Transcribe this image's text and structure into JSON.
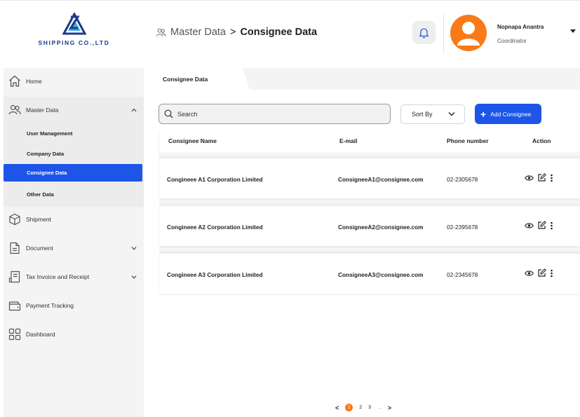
{
  "brand": {
    "name": "SHIPPING CO.,LTD"
  },
  "breadcrumb": {
    "parent": "Master Data",
    "separator": ">",
    "current": "Consignee Data"
  },
  "user": {
    "name": "Nopnapa Anantra",
    "role": "Coordinator"
  },
  "sidebar": {
    "items": [
      {
        "label": "Home"
      },
      {
        "label": "Master Data"
      },
      {
        "label": "Shipment"
      },
      {
        "label": "Document"
      },
      {
        "label": "Tax Invoice and Receipt"
      },
      {
        "label": "Payment Tracking"
      },
      {
        "label": "Dashboard"
      }
    ],
    "sub_items": [
      {
        "label": "User Management"
      },
      {
        "label": "Company Data"
      },
      {
        "label": "Consignee Data"
      },
      {
        "label": "Other Data"
      }
    ],
    "active_sub": "Consignee Data"
  },
  "tab": {
    "label": "Consignee Data"
  },
  "toolbar": {
    "search_placeholder": "Search",
    "sort_label": "Sort By",
    "add_label": "Add Consignee"
  },
  "table": {
    "headers": [
      "Consignee Name",
      "E-mail",
      "Phone number",
      "Action"
    ],
    "rows": [
      {
        "name": "Congineee A1 Corporation Limited",
        "email": "ConsigneeA1@consignee.com",
        "phone": "02-2305678"
      },
      {
        "name": "Congineee A2 Corporation Limited",
        "email": "ConsigneeA2@consignee.com",
        "phone": "02-2395678"
      },
      {
        "name": "Congineee A3 Corporation Limited",
        "email": "ConsigneeA3@consignee.com",
        "phone": "02-2345678"
      }
    ]
  },
  "pagination": {
    "prev": "<",
    "pages": [
      "1",
      "2",
      "3",
      "..."
    ],
    "next": ">",
    "current": "1"
  },
  "colors": {
    "primary": "#1d55e8",
    "accent": "#f97a16",
    "brand_text": "#1d3a8a"
  }
}
